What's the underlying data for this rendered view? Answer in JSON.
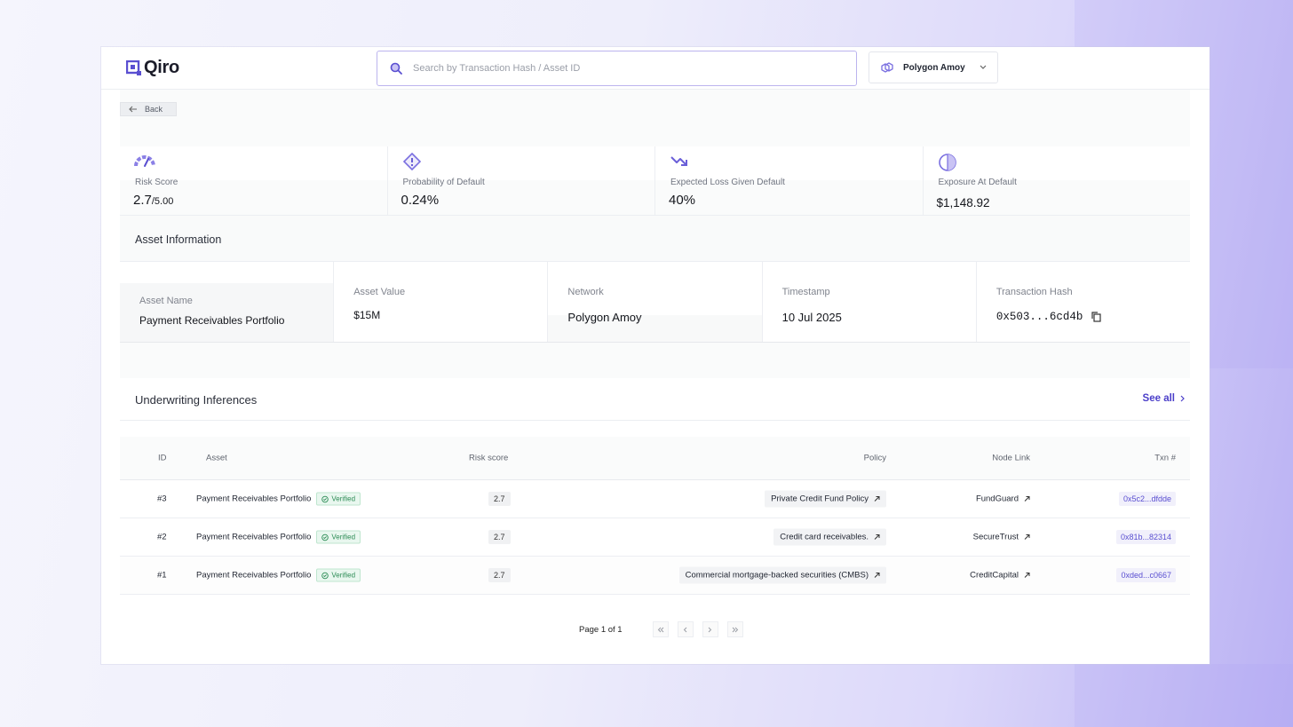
{
  "app": {
    "name": "Qiro"
  },
  "search": {
    "placeholder": "Search by Transaction Hash / Asset ID",
    "value": ""
  },
  "network_select": {
    "selected": "Polygon Amoy"
  },
  "back_label": "Back",
  "metrics": [
    {
      "icon": "gauge-icon",
      "label": "Risk Score",
      "value": "2.7",
      "suffix": "/5.00"
    },
    {
      "icon": "warning-diamond-icon",
      "label": "Probability of Default",
      "value": "0.24%",
      "suffix": ""
    },
    {
      "icon": "trend-down-icon",
      "label": "Expected Loss Given Default",
      "value": "40%",
      "suffix": ""
    },
    {
      "icon": "half-circle-icon",
      "label": "Exposure At Default",
      "value": "$1,148.92",
      "suffix": ""
    }
  ],
  "asset_info": {
    "title": "Asset Information",
    "fields": [
      {
        "label": "Asset Name",
        "value": "Payment Receivables Portfolio"
      },
      {
        "label": "Asset Value",
        "value": "$15M"
      },
      {
        "label": "Network",
        "value": "Polygon Amoy"
      },
      {
        "label": "Timestamp",
        "value": "10 Jul 2025"
      },
      {
        "label": "Transaction Hash",
        "value": "0x503...6cd4b"
      }
    ]
  },
  "underwriting": {
    "title": "Underwriting Inferences",
    "see_all": "See all",
    "columns": {
      "id": "ID",
      "asset": "Asset",
      "risk": "Risk score",
      "policy": "Policy",
      "node": "Node Link",
      "txn": "Txn #"
    },
    "rows": [
      {
        "id": "#3",
        "asset": "Payment Receivables Portfolio",
        "status": "Verified",
        "risk": "2.7",
        "policy": "Private Credit Fund Policy",
        "node": "FundGuard",
        "txn": "0x5c2...dfdde"
      },
      {
        "id": "#2",
        "asset": "Payment Receivables Portfolio",
        "status": "Verified",
        "risk": "2.7",
        "policy": "Credit card receivables.",
        "node": "SecureTrust",
        "txn": "0x81b...82314"
      },
      {
        "id": "#1",
        "asset": "Payment Receivables Portfolio",
        "status": "Verified",
        "risk": "2.7",
        "policy": "Commercial mortgage-backed securities (CMBS)",
        "node": "CreditCapital",
        "txn": "0xded...c0667"
      }
    ],
    "pagination": {
      "label": "Page 1 of 1"
    }
  },
  "colors": {
    "accent": "#5a4fd1",
    "verified": "#2c8c55",
    "border": "#eceef2"
  }
}
